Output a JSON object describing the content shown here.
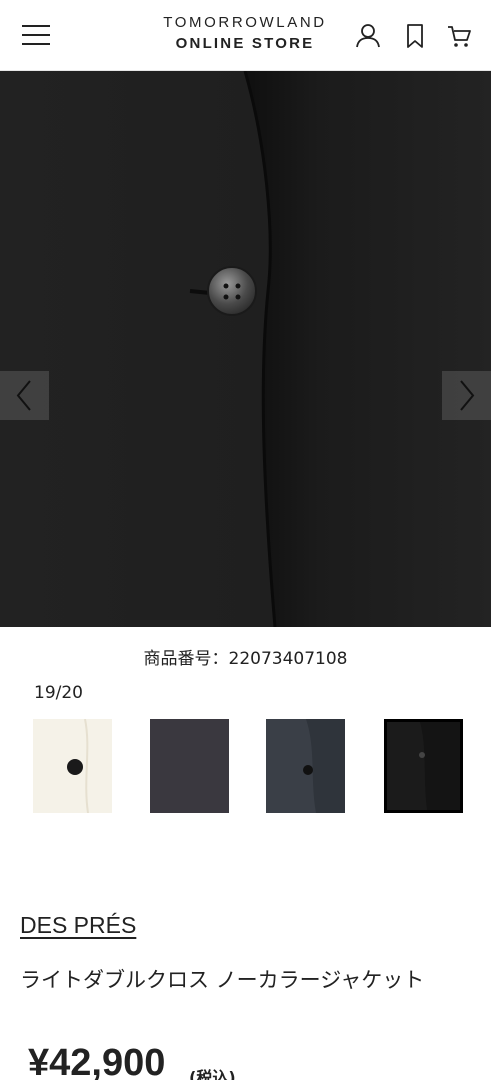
{
  "header": {
    "logo_line1": "TOMORROWLAND",
    "logo_line2": "ONLINE STORE",
    "icons": [
      "menu-icon",
      "user-icon",
      "bookmark-icon",
      "cart-icon"
    ]
  },
  "gallery": {
    "product_code": "商品番号：22073407108",
    "counter": "19/20",
    "thumbnails": [
      {
        "color": "#f4f1e8",
        "icon": "thumbnail-ivory"
      },
      {
        "color": "#3c3a40",
        "icon": "thumbnail-charcoal"
      },
      {
        "color": "#3a3f47",
        "icon": "thumbnail-navy"
      },
      {
        "color": "#1a1a1a",
        "icon": "thumbnail-black"
      }
    ],
    "selected_thumbnail": 4
  },
  "product": {
    "brand": "DES PRÉS",
    "title": "ライトダブルクロス ノーカラージャケット",
    "price": "¥42,900",
    "tax_label": "(税込)"
  }
}
